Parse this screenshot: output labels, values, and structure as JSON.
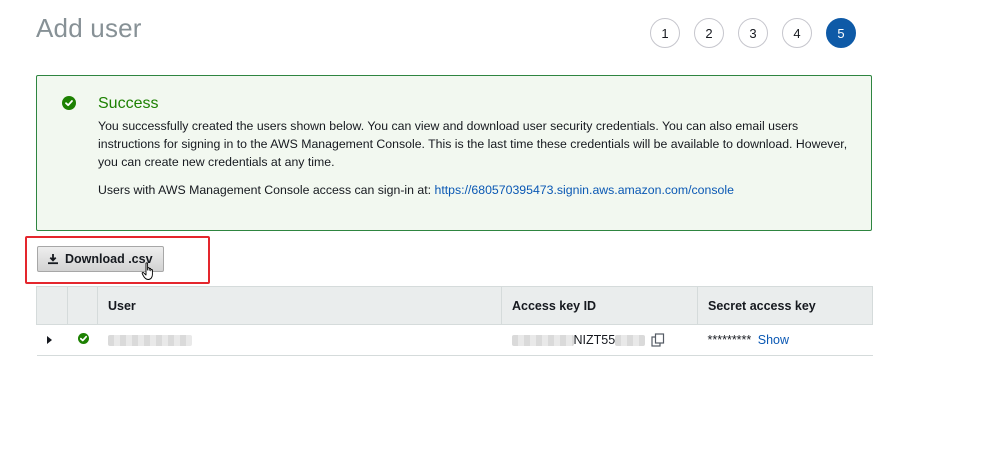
{
  "page": {
    "title": "Add user"
  },
  "steps": [
    {
      "label": "1",
      "active": false
    },
    {
      "label": "2",
      "active": false
    },
    {
      "label": "3",
      "active": false
    },
    {
      "label": "4",
      "active": false
    },
    {
      "label": "5",
      "active": true
    }
  ],
  "success": {
    "title": "Success",
    "message": "You successfully created the users shown below. You can view and download user security credentials. You can also email users instructions for signing in to the AWS Management Console. This is the last time these credentials will be available to download. However, you can create new credentials at any time.",
    "signin_prefix": "Users with AWS Management Console access can sign-in at: ",
    "signin_url": "https://680570395473.signin.aws.amazon.com/console"
  },
  "actions": {
    "download_label": "Download .csv"
  },
  "table": {
    "headers": {
      "user": "User",
      "access_key_id": "Access key ID",
      "secret_access_key": "Secret access key"
    },
    "rows": [
      {
        "access_key_visible": "NIZT55",
        "secret_masked": "*********",
        "show_label": "Show"
      }
    ]
  },
  "colors": {
    "success": "#1d8102",
    "step_active": "#0e5aa7",
    "link": "#0a58b4",
    "highlight": "#e4262d"
  }
}
